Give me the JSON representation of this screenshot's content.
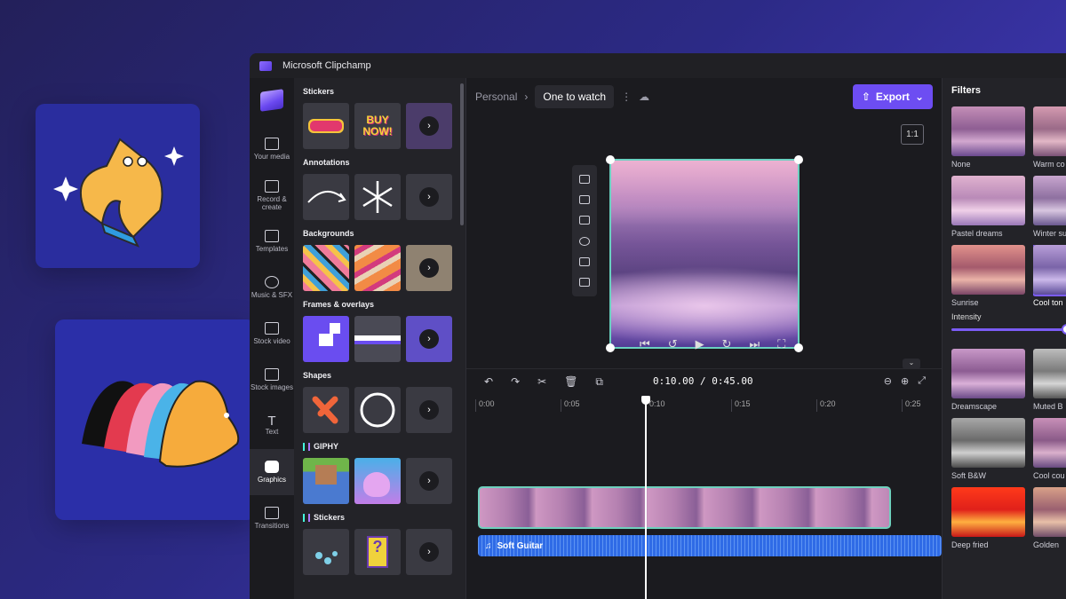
{
  "app": {
    "title": "Microsoft Clipchamp"
  },
  "rail": {
    "items": [
      {
        "label": "Your media"
      },
      {
        "label": "Record & create"
      },
      {
        "label": "Templates"
      },
      {
        "label": "Music & SFX"
      },
      {
        "label": "Stock video"
      },
      {
        "label": "Stock images"
      },
      {
        "label": "Text"
      },
      {
        "label": "Graphics"
      },
      {
        "label": "Transitions"
      }
    ]
  },
  "library": {
    "sections": [
      {
        "title": "Stickers"
      },
      {
        "title": "Annotations"
      },
      {
        "title": "Backgrounds"
      },
      {
        "title": "Frames & overlays"
      },
      {
        "title": "Shapes"
      },
      {
        "title": "GIPHY"
      },
      {
        "title": "Stickers"
      }
    ],
    "sticker_text": "BUY NOW!"
  },
  "header": {
    "breadcrumb_root": "Personal",
    "project_name": "One to watch",
    "export_label": "Export"
  },
  "preview": {
    "ratio_label": "1:1"
  },
  "timeline": {
    "timecode": "0:10.00 / 0:45.00",
    "ruler": [
      "0:00",
      "0:05",
      "0:10",
      "0:15",
      "0:20",
      "0:25"
    ],
    "audio_label": "Soft Guitar"
  },
  "filters": {
    "title": "Filters",
    "items": [
      {
        "label": "None"
      },
      {
        "label": "Warm co"
      },
      {
        "label": "Pastel dreams"
      },
      {
        "label": "Winter su"
      },
      {
        "label": "Sunrise"
      },
      {
        "label": "Cool ton"
      },
      {
        "label": "Dreamscape"
      },
      {
        "label": "Muted B"
      },
      {
        "label": "Soft B&W"
      },
      {
        "label": "Cool cou"
      },
      {
        "label": "Deep fried"
      },
      {
        "label": "Golden"
      }
    ],
    "intensity_label": "Intensity",
    "intensity_value": 1.0
  },
  "colors": {
    "accent": "#6d4df2",
    "clip_border": "#6fd0bd",
    "audio": "#2f6be6"
  }
}
